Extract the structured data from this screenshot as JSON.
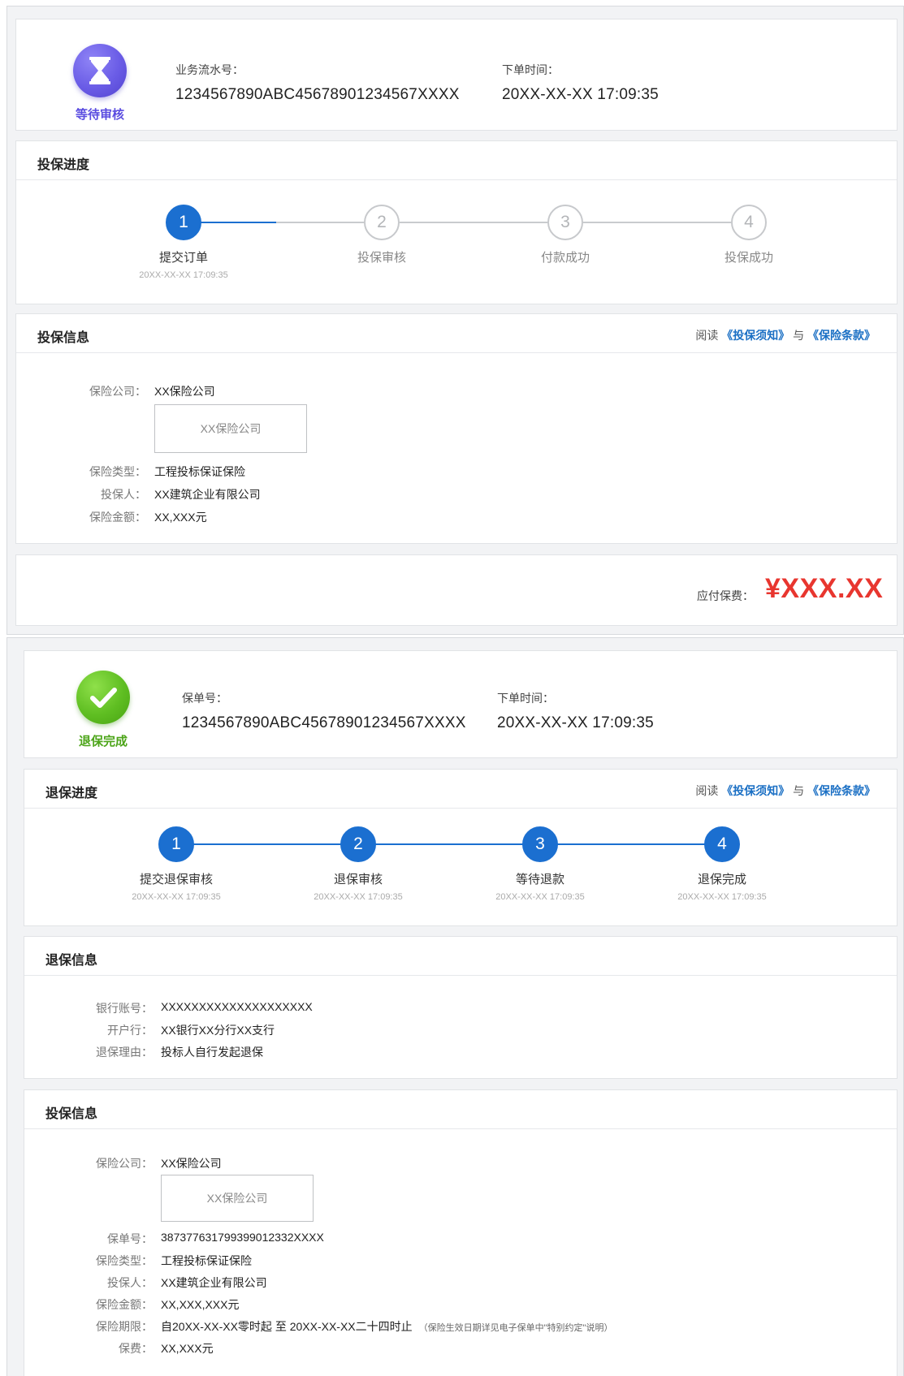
{
  "colors": {
    "primary_blue": "#1b6fd0",
    "pending_purple": "#5a4ce0",
    "success_green": "#5fbe22",
    "price_red": "#e8362f",
    "inactive_gray": "#c7c9cc"
  },
  "top": {
    "status": {
      "icon": "hourglass-icon",
      "label": "等待审核"
    },
    "serial": {
      "label": "业务流水号：",
      "value": "1234567890ABC45678901234567XXXX"
    },
    "order_time": {
      "label": "下单时间：",
      "value": "20XX-XX-XX 17:09:35"
    },
    "progress": {
      "title": "投保进度",
      "steps": [
        {
          "num": "1",
          "label": "提交订单",
          "time": "20XX-XX-XX 17:09:35",
          "active": true
        },
        {
          "num": "2",
          "label": "投保审核",
          "time": "",
          "active": false
        },
        {
          "num": "3",
          "label": "付款成功",
          "time": "",
          "active": false
        },
        {
          "num": "4",
          "label": "投保成功",
          "time": "",
          "active": false
        }
      ]
    },
    "info": {
      "title": "投保信息",
      "read_prefix": "阅读",
      "link_notice": "《投保须知》",
      "link_and": "与",
      "link_terms": "《保险条款》",
      "company_label": "保险公司：",
      "company_value": "XX保险公司",
      "company_logo_text": "XX保险公司",
      "type_label": "保险类型：",
      "type_value": "工程投标保证保险",
      "applicant_label": "投保人：",
      "applicant_value": "XX建筑企业有限公司",
      "amount_label": "保险金额：",
      "amount_value": "XX,XXX元"
    },
    "payment": {
      "label": "应付保费：",
      "amount": "¥XXX.XX"
    }
  },
  "bottom": {
    "status": {
      "icon": "checkmark-icon",
      "label": "退保完成"
    },
    "policy_no": {
      "label": "保单号：",
      "value": "1234567890ABC45678901234567XXXX"
    },
    "order_time": {
      "label": "下单时间：",
      "value": "20XX-XX-XX 17:09:35"
    },
    "progress": {
      "title": "退保进度",
      "read_prefix": "阅读",
      "link_notice": "《投保须知》",
      "link_and": "与",
      "link_terms": "《保险条款》",
      "steps": [
        {
          "num": "1",
          "label": "提交退保审核",
          "time": "20XX-XX-XX 17:09:35",
          "active": true
        },
        {
          "num": "2",
          "label": "退保审核",
          "time": "20XX-XX-XX 17:09:35",
          "active": true
        },
        {
          "num": "3",
          "label": "等待退款",
          "time": "20XX-XX-XX 17:09:35",
          "active": true
        },
        {
          "num": "4",
          "label": "退保完成",
          "time": "20XX-XX-XX 17:09:35",
          "active": true
        }
      ]
    },
    "refund": {
      "title": "退保信息",
      "account_label": "银行账号：",
      "account_value": "XXXXXXXXXXXXXXXXXXXX",
      "bank_label": "开户行：",
      "bank_value": "XX银行XX分行XX支行",
      "reason_label": "退保理由：",
      "reason_value": "投标人自行发起退保"
    },
    "info": {
      "title": "投保信息",
      "company_label": "保险公司：",
      "company_value": "XX保险公司",
      "company_logo_text": "XX保险公司",
      "policy_label": "保单号：",
      "policy_value": "387377631799399012332XXXX",
      "type_label": "保险类型：",
      "type_value": "工程投标保证保险",
      "applicant_label": "投保人：",
      "applicant_value": "XX建筑企业有限公司",
      "amount_label": "保险金额：",
      "amount_value": "XX,XXX,XXX元",
      "period_label": "保险期限：",
      "period_value": "自20XX-XX-XX零时起 至 20XX-XX-XX二十四时止",
      "period_note": "（保险生效日期详见电子保单中\"特别约定\"说明）",
      "premium_label": "保费：",
      "premium_value": "XX,XXX元"
    }
  }
}
